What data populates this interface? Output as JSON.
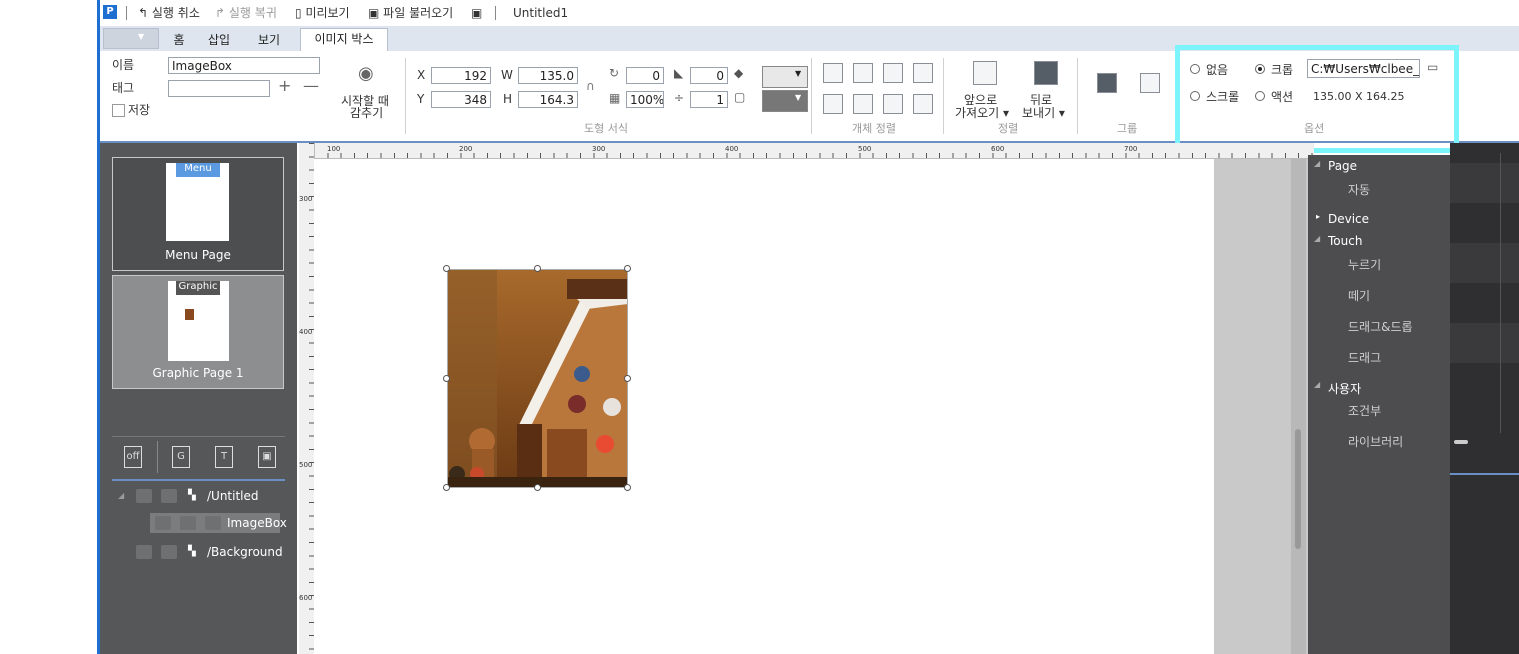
{
  "window": {
    "title": "Untitled1",
    "toolbar": {
      "undo": "실행 취소",
      "redo": "실행 복귀",
      "preview": "미리보기",
      "load_file": "파일 불러오기"
    }
  },
  "tabs": [
    "홈",
    "삽입",
    "보기",
    "이미지 박스"
  ],
  "ribbon": {
    "name_label": "이름",
    "name_value": "ImageBox",
    "tag_label": "태그",
    "tag_value": "",
    "save_label": "저장",
    "hide_label_1": "시작할 때",
    "hide_label_2": "감추기",
    "x_label": "X",
    "x_value": "192",
    "y_label": "Y",
    "y_value": "348",
    "w_label": "W",
    "w_value": "135.0",
    "h_label": "H",
    "h_value": "164.3",
    "rotate_value": "0",
    "corner_value": "0",
    "opacity_value": "100%",
    "line_value": "1",
    "shape_format_group": "도형 서식",
    "align_group": "개체 정렬",
    "bring_front_1": "앞으로",
    "bring_front_2": "가져오기 ▾",
    "send_back_1": "뒤로",
    "send_back_2": "보내기 ▾",
    "order_group": "정렬",
    "group_group": "그룹",
    "options": {
      "none": "없음",
      "crop": "크롭",
      "path_value": "C:₩Users₩clbee_pu",
      "scroll": "스크롤",
      "action": "액션",
      "size_text": "135.00 X 164.25",
      "group_label": "옵션",
      "selected": "크롭"
    }
  },
  "pages": [
    {
      "tag": "Menu",
      "caption": "Menu Page"
    },
    {
      "tag": "Graphic",
      "caption": "Graphic Page 1"
    }
  ],
  "layer_buttons": [
    "off",
    "G",
    "T",
    "▣"
  ],
  "layers": [
    {
      "name": "/Untitled"
    },
    {
      "name": "ImageBox"
    },
    {
      "name": "/Background"
    }
  ],
  "rulers": {
    "h": [
      "100",
      "200",
      "300",
      "400",
      "500",
      "600",
      "700"
    ],
    "v": [
      "300",
      "400",
      "500",
      "600"
    ]
  },
  "events": {
    "page": "Page",
    "page_auto": "자동",
    "device": "Device",
    "touch": "Touch",
    "touch_items": [
      "누르기",
      "떼기",
      "드래그&드롭",
      "드래그"
    ],
    "user": "사용자",
    "user_items": [
      "조건부",
      "라이브러리"
    ]
  },
  "colors": {
    "accent": "#1e6fcf",
    "highlight": "#7cf4fb",
    "panel_dark": "#555759",
    "menu_tag": "#5b9ae0"
  }
}
